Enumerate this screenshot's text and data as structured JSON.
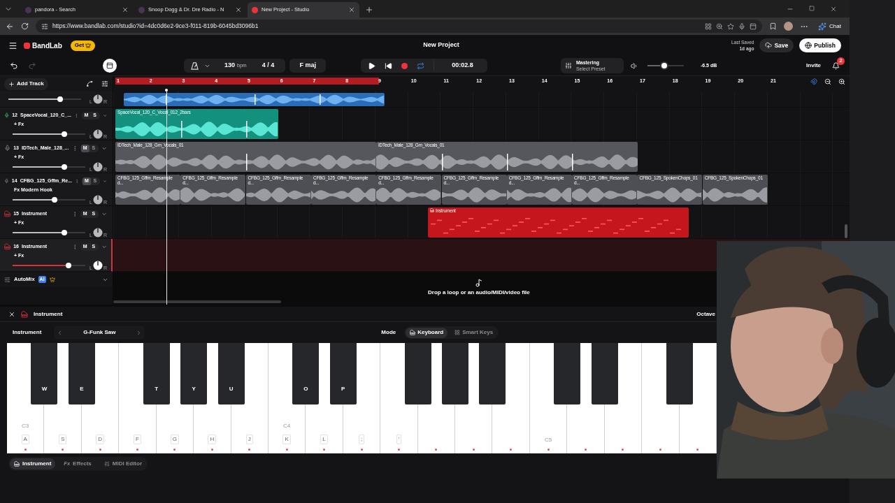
{
  "browser": {
    "tabs": [
      {
        "title": "pandora - Search",
        "selected": false
      },
      {
        "title": "Snoop Dogg & Dr. Dre Radio - N",
        "selected": false
      },
      {
        "title": "New Project - Studio",
        "selected": true
      }
    ],
    "url": "https://www.bandlab.com/studio?id=4dc0d6e2-9ce3-f011-819b-6045bd3096b1",
    "chat": "Chat"
  },
  "app": {
    "brand": "BandLab",
    "get": "Get",
    "title": "New Project",
    "last_saved": "Last Saved",
    "last_saved_time": "1d ago",
    "save": "Save",
    "publish": "Publish"
  },
  "toolbar": {
    "tempo": "130",
    "tempo_unit": "bpm",
    "meter": "4 / 4",
    "key": "F maj",
    "loop": true,
    "time": "00:02.8",
    "mastering": "Mastering",
    "mastering_preset": "Select Preset",
    "volume": {
      "level": 0.47,
      "reading": "-6.5 dB"
    },
    "invite": "Invite",
    "notifications": "2"
  },
  "add_track": "Add Track",
  "ruler": [
    "1",
    "2",
    "3",
    "4",
    "5",
    "6",
    "7",
    "8",
    "9",
    "10",
    "11",
    "12",
    "13",
    "14",
    "15",
    "16",
    "17",
    "18",
    "19",
    "20",
    "21"
  ],
  "tracks": [
    {
      "kind": "partial",
      "level": 0.71,
      "pan_left": "L",
      "pan_right": "R",
      "clips": [
        {
          "color": "#2a6cb5"
        }
      ]
    },
    {
      "kind": "audio",
      "number": "12",
      "name": "SpaceVocal_120_C_...",
      "fx": "+ Fx",
      "armed": true,
      "mute_label": "M",
      "solo_label": "S",
      "muted": false,
      "level": 0.71,
      "pan_left": "L",
      "pan_right": "R",
      "selected": false,
      "clips": [
        {
          "label": "SpaceVocal_120_C_Vocal_012_2bars",
          "color": "#14907f"
        }
      ]
    },
    {
      "kind": "audio",
      "number": "13",
      "name": "IDTech_Male_128_...",
      "fx": "+ Fx",
      "armed": false,
      "mute_label": "M",
      "solo_label": "S",
      "muted": true,
      "level": 0.71,
      "pan_left": "L",
      "pan_right": "R",
      "selected": false,
      "clips": [
        {
          "label": "IDTech_Male_128_Gm_Vocals_01",
          "color": "#55575c"
        },
        {
          "label": "IDTech_Male_128_Gm_Vocals_01",
          "color": "#55575c"
        }
      ]
    },
    {
      "kind": "audio",
      "number": "14",
      "name": "CFBG_125_Gffm_Re...",
      "fx": "Fx Modern Hook",
      "armed": false,
      "mute_label": "M",
      "solo_label": "S",
      "muted": true,
      "level": 0.58,
      "pan_left": "L",
      "pan_right": "R",
      "selected": false,
      "clips": [
        {
          "label": "CFBG_125_Gffm_Resampled...",
          "color": "#4d4f54"
        },
        {
          "label": "CFBG_125_Gffm_Resampled...",
          "color": "#4d4f54"
        },
        {
          "label": "CFBG_125_Gffm_Resampled...",
          "color": "#4d4f54"
        },
        {
          "label": "CFBG_125_Gffm_Resampled...",
          "color": "#4d4f54"
        },
        {
          "label": "CFBG_125_Gffm_Resampled...",
          "color": "#4d4f54"
        },
        {
          "label": "CFBG_125_Gffm_Resampled...",
          "color": "#4d4f54"
        },
        {
          "label": "CFBG_125_Gffm_Resampled...",
          "color": "#4d4f54"
        },
        {
          "label": "CFBG_125_Gffm_Resampled...",
          "color": "#4d4f54"
        },
        {
          "label": "CFBG_125_SpokenChops_01",
          "color": "#4d4f54"
        },
        {
          "label": "CFBG_125_SpokenChops_01",
          "color": "#4d4f54"
        }
      ]
    },
    {
      "kind": "instrument",
      "number": "15",
      "name": "Instrument",
      "fx": "+ Fx",
      "mute_label": "M",
      "solo_label": "S",
      "muted": false,
      "level": 0.71,
      "pan_left": "L",
      "pan_right": "R",
      "selected": false,
      "clips": [
        {
          "label": "Instrument",
          "color": "#c4161c"
        }
      ]
    },
    {
      "kind": "instrument",
      "number": "16",
      "name": "Instrument",
      "fx": "+ Fx",
      "mute_label": "M",
      "solo_label": "S",
      "muted": false,
      "level": 0.77,
      "pan_left": "L",
      "pan_right": "R",
      "selected": true
    }
  ],
  "automix": {
    "label": "AutoMix",
    "badge": "AI"
  },
  "drop_hint": "Drop a loop or an audio/MIDI/video file",
  "instrument_panel": {
    "title": "Instrument",
    "octave": "Octave",
    "instrument_label": "Instrument",
    "instrument": "G-Funk Saw",
    "mode_label": "Mode",
    "modes": [
      {
        "label": "Keyboard",
        "selected": true
      },
      {
        "label": "Smart Keys",
        "selected": false
      }
    ],
    "white_keys": [
      {
        "kind": "lettered",
        "label": "A",
        "note": "C3"
      },
      {
        "kind": "lettered",
        "label": "S"
      },
      {
        "kind": "lettered",
        "label": "D"
      },
      {
        "kind": "lettered",
        "label": "F"
      },
      {
        "kind": "lettered",
        "label": "G"
      },
      {
        "kind": "lettered",
        "label": "H"
      },
      {
        "kind": "lettered",
        "label": "J"
      },
      {
        "kind": "lettered",
        "label": "K",
        "note": "C4"
      },
      {
        "kind": "lettered",
        "label": "L"
      },
      {
        "kind": "lettered",
        "label": ";"
      },
      {
        "kind": "lettered",
        "label": "'"
      },
      {
        "kind": "blank"
      },
      {
        "kind": "blank"
      },
      {
        "kind": "blank"
      },
      {
        "kind": "blank",
        "note": "C5"
      },
      {
        "kind": "blank"
      },
      {
        "kind": "blank"
      },
      {
        "kind": "blank"
      },
      {
        "kind": "blank"
      }
    ],
    "black_keys": [
      {
        "kind": "lettered",
        "label": "W"
      },
      {
        "kind": "lettered",
        "label": "E"
      },
      {
        "kind": "lettered",
        "label": "T"
      },
      {
        "kind": "lettered",
        "label": "Y"
      },
      {
        "kind": "lettered",
        "label": "U"
      },
      {
        "kind": "lettered",
        "label": "O"
      },
      {
        "kind": "lettered",
        "label": "P"
      },
      {
        "kind": "blank"
      },
      {
        "kind": "blank"
      },
      {
        "kind": "blank"
      },
      {
        "kind": "blank"
      },
      {
        "kind": "blank"
      },
      {
        "kind": "blank"
      }
    ],
    "tabs": [
      {
        "label": "Instrument",
        "selected": true
      },
      {
        "label": "Effects",
        "prefix": "Fx",
        "selected": false
      },
      {
        "label": "MIDI Editor",
        "selected": false
      }
    ]
  }
}
